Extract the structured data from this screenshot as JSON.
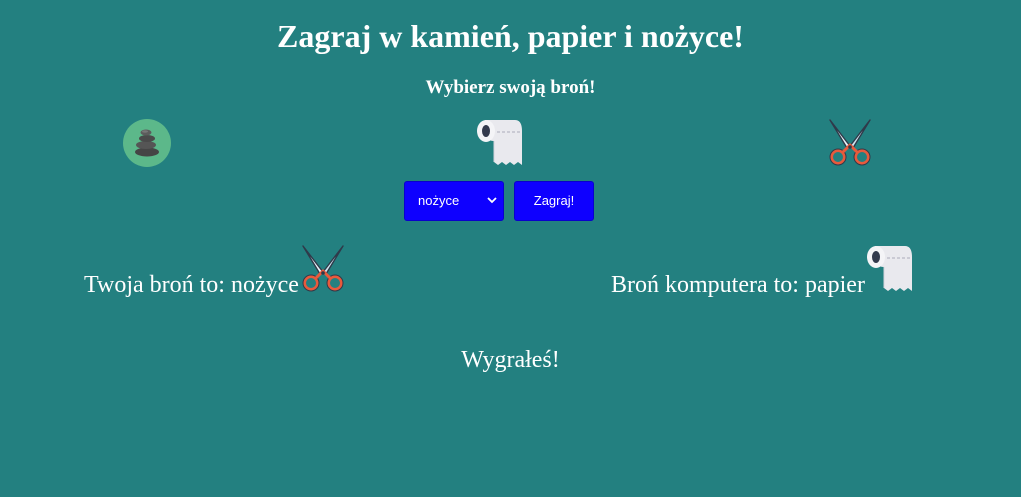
{
  "header": {
    "title": "Zagraj w kamień, papier i nożyce!",
    "subtitle": "Wybierz swoją broń!"
  },
  "weapons": [
    {
      "id": "kamien",
      "icon": "rock-icon"
    },
    {
      "id": "papier",
      "icon": "toilet-paper-icon"
    },
    {
      "id": "nozyce",
      "icon": "scissors-icon"
    }
  ],
  "controls": {
    "select_value": "nożyce",
    "play_label": "Zagraj!",
    "button_color": "#0e00ff"
  },
  "result": {
    "player_text": "Twoja broń to: nożyce",
    "player_icon": "scissors-icon",
    "computer_text": "Broń komputera to: papier",
    "computer_icon": "toilet-paper-icon",
    "outcome": "Wygrałeś!"
  },
  "colors": {
    "background": "#238080",
    "text": "#ffffff"
  }
}
